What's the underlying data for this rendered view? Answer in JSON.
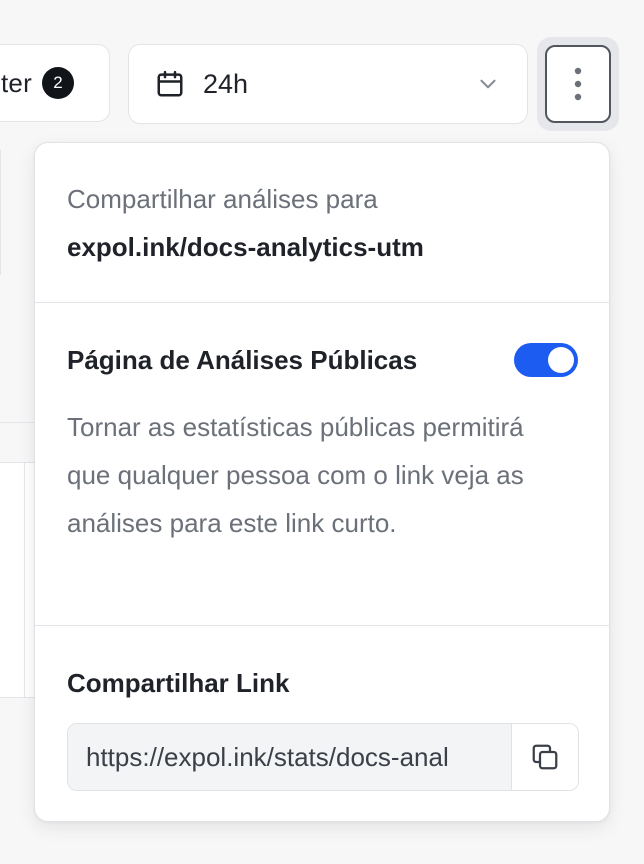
{
  "toolbar": {
    "filter_label": "ter",
    "filter_count": "2",
    "date_range": "24h"
  },
  "popover": {
    "share_caption": "Compartilhar análises para",
    "share_target": "expol.ink/docs-analytics-utm",
    "public_title": "Página de Análises Públicas",
    "public_enabled": true,
    "public_description": "Tornar as estatísticas públicas permitirá que qualquer pessoa com o link veja as análises para este link curto.",
    "link_title": "Compartilhar Link",
    "link_value": "https://expol.ink/stats/docs-anal"
  },
  "colors": {
    "toggle_on": "#1c5cf0",
    "badge_bg": "#111418"
  },
  "icons": {
    "date": "calendar-icon",
    "select": "chevron-down-icon",
    "more": "more-vertical-icon",
    "copy": "copy-icon"
  }
}
